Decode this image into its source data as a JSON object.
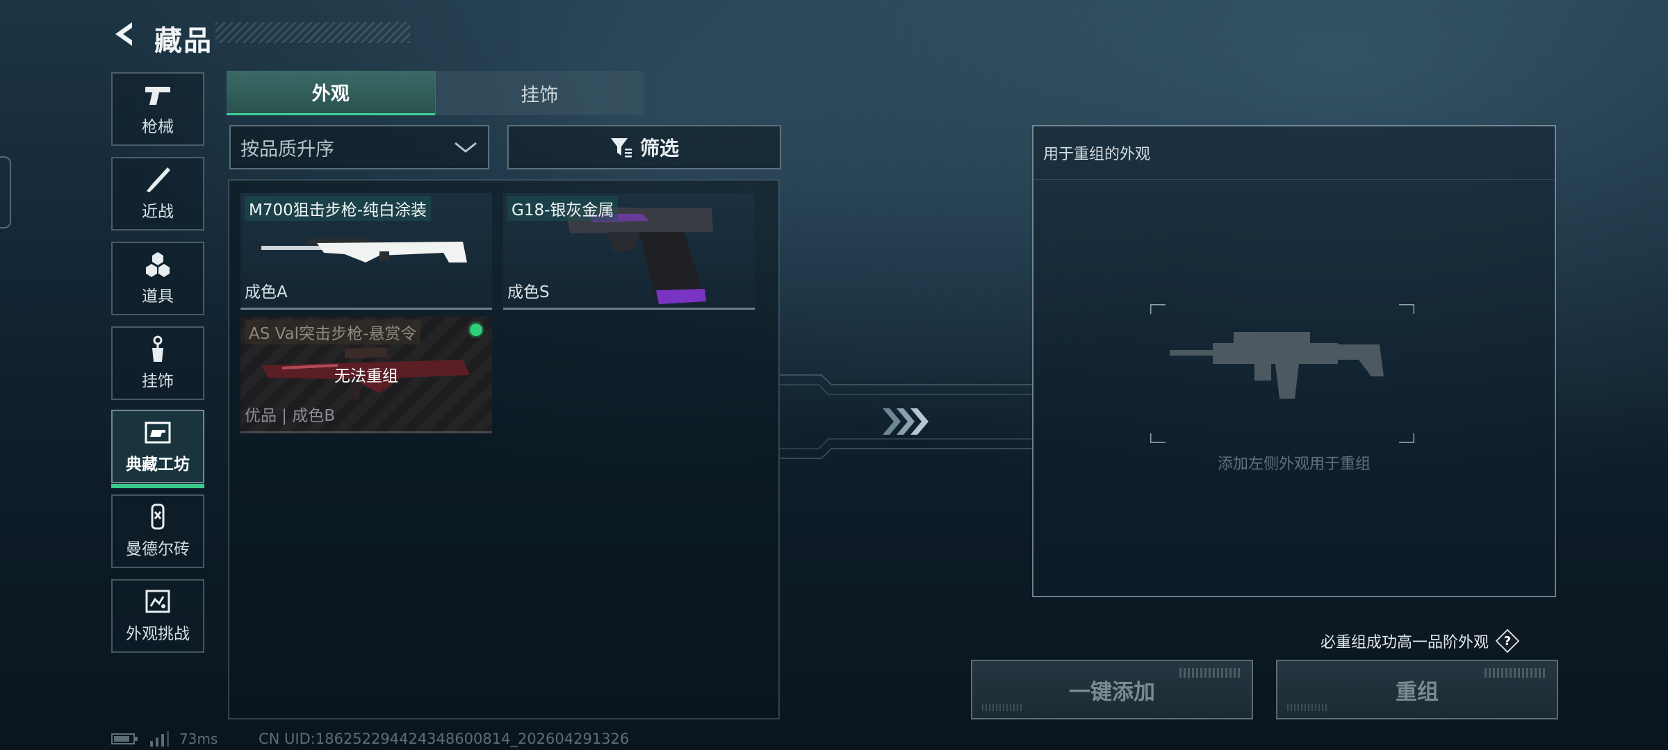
{
  "header": {
    "title": "藏品",
    "back_icon": "back-arrow-icon"
  },
  "sidebar": {
    "items": [
      {
        "label": "枪械",
        "icon": "pistol-icon",
        "active": false
      },
      {
        "label": "近战",
        "icon": "knife-icon",
        "active": false
      },
      {
        "label": "道具",
        "icon": "grenade-icon",
        "active": false
      },
      {
        "label": "挂饰",
        "icon": "charm-icon",
        "active": false
      },
      {
        "label": "典藏工坊",
        "icon": "workshop-icon",
        "active": true
      },
      {
        "label": "曼德尔砖",
        "icon": "brick-icon",
        "active": false
      },
      {
        "label": "外观挑战",
        "icon": "challenge-icon",
        "active": false
      }
    ]
  },
  "tabs": [
    {
      "label": "外观",
      "active": true
    },
    {
      "label": "挂饰",
      "active": false
    }
  ],
  "sort": {
    "label": "按品质升序"
  },
  "filter": {
    "label": "筛选"
  },
  "items": [
    {
      "name": "M700狙击步枪-纯白涂装",
      "grade": "成色A",
      "status": "",
      "disabled": false
    },
    {
      "name": "G18-银灰金属",
      "grade": "成色S",
      "status": "",
      "disabled": false
    },
    {
      "name": "AS Val突击步枪-悬赏令",
      "grade": "优品 | 成色B",
      "status": "无法重组",
      "disabled": true,
      "equipped": true
    }
  ],
  "recombine_panel": {
    "title": "用于重组的外观",
    "hint": "添加左侧外观用于重组"
  },
  "guarantee": {
    "text": "必重组成功高一品阶外观",
    "help_label": "?"
  },
  "buttons": {
    "add_all": "一键添加",
    "recombine": "重组"
  },
  "status_bar": {
    "ping": "73ms",
    "uid": "CN UID:18625229442434860081​4_202604291326"
  },
  "colors": {
    "accent": "#39c98b",
    "active_tab": "#2f5a57",
    "background": "#0f1f2b"
  }
}
